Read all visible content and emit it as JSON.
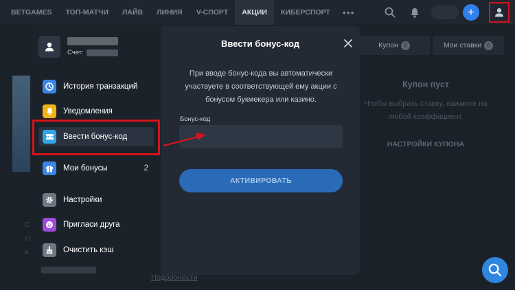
{
  "nav": {
    "items": [
      {
        "label": "BETGAMES",
        "active": false
      },
      {
        "label": "ТОП-МАТЧИ",
        "active": false
      },
      {
        "label": "ЛАЙВ",
        "active": false
      },
      {
        "label": "ЛИНИЯ",
        "active": false
      },
      {
        "label": "V-СПОРТ",
        "active": false
      },
      {
        "label": "АКЦИИ",
        "active": true
      },
      {
        "label": "КИБЕРСПОРТ",
        "active": false
      }
    ],
    "more": "•••",
    "plus": "+",
    "icons": [
      "search-icon",
      "bell-icon",
      "plus-icon",
      "user-icon"
    ]
  },
  "background": {
    "coupon_tab": "Купон",
    "coupon_count": "0",
    "bets_tab": "Мои ставки",
    "bets_count": "0",
    "empty_title": "Купон пуст",
    "empty_desc": "Чтобы выбрать ставку, нажмите на любой коэффициент.",
    "settings": "НАСТРОЙКИ КУПОНА",
    "details": "Подробности",
    "stub1": "С",
    "stub2": "ст",
    "stub3": "и"
  },
  "profile": {
    "account_label": "Счет:"
  },
  "menu": {
    "items": [
      {
        "label": "История транзакций",
        "icon": "clock-icon",
        "color": "#3a86e8"
      },
      {
        "label": "Уведомления",
        "icon": "bell-icon",
        "color": "#f0b418"
      },
      {
        "label": "Ввести бонус-код",
        "icon": "ticket-icon",
        "color": "#2fa6e8",
        "active": true
      },
      {
        "label": "Мои бонусы",
        "icon": "gift-icon",
        "color": "#3a86e8",
        "count": "2"
      },
      {
        "label": "Настройки",
        "icon": "gear-icon",
        "color": "#6f7883"
      },
      {
        "label": "Пригласи друга",
        "icon": "smile-icon",
        "color": "#9b4dd8"
      },
      {
        "label": "Очистить кэш",
        "icon": "broom-icon",
        "color": "#6f7883"
      }
    ]
  },
  "panel": {
    "title": "Ввести бонус-код",
    "description": "При вводе бонус-кода вы автоматически участвуете в соответствующей ему акции с бонусом букмекера или казино.",
    "field_label": "Бонус-код",
    "field_value": "",
    "activate_label": "АКТИВИРОВАТЬ"
  },
  "colors": {
    "accent": "#2f80ed",
    "highlight": "#d6131b",
    "button": "#2a6bb8"
  }
}
